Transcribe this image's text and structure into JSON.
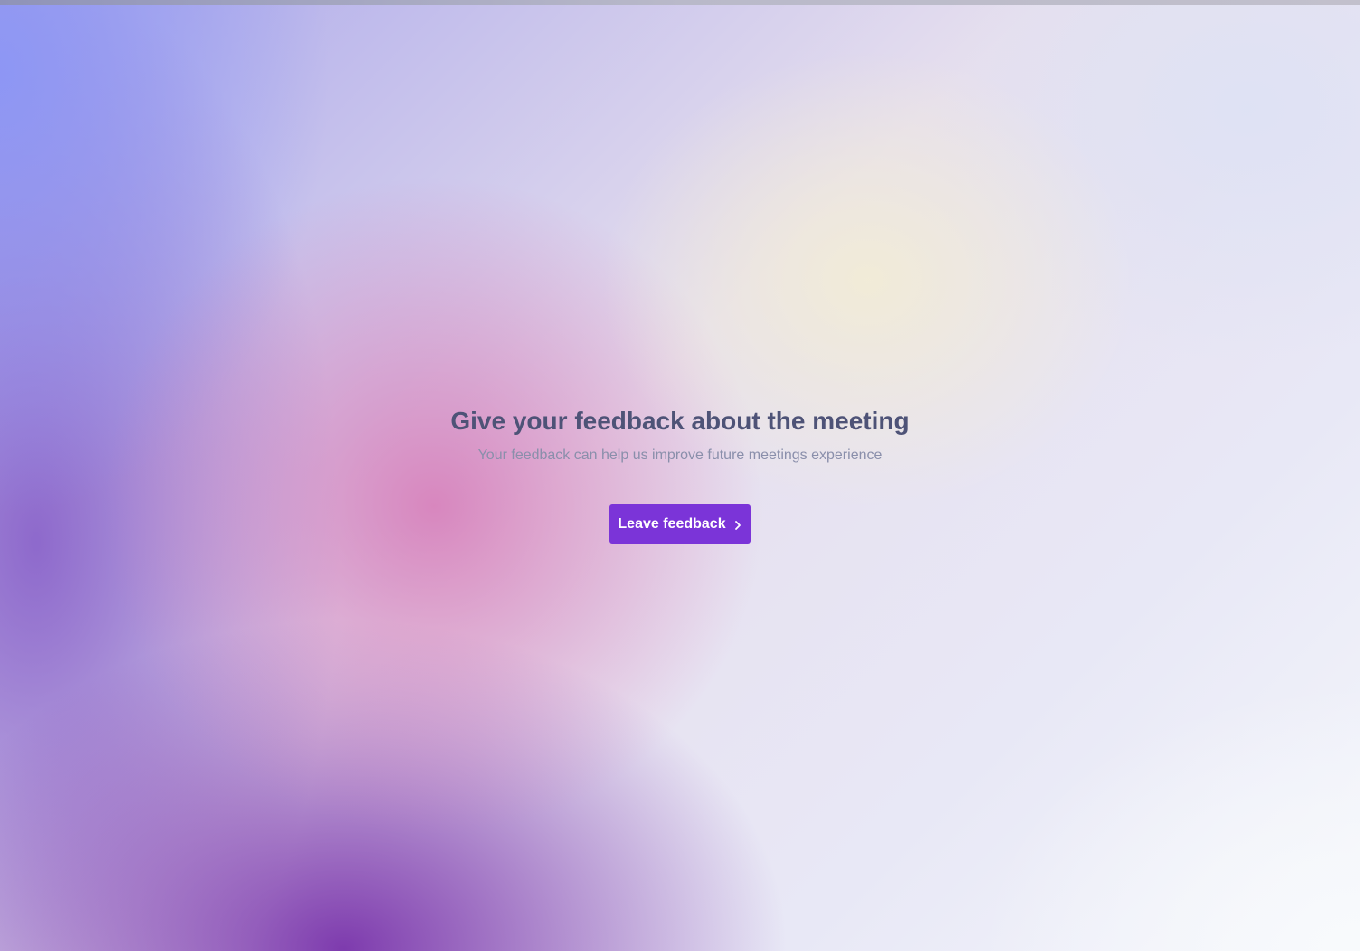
{
  "colors": {
    "accent": "#7b34d8",
    "title": "#4e5377",
    "subtitle": "#8a8fab"
  },
  "main": {
    "title": "Give your feedback about the meeting",
    "subtitle": "Your feedback can help us improve future meetings experience",
    "cta": {
      "label": "Leave feedback",
      "icon": "chevron-right-icon"
    }
  }
}
